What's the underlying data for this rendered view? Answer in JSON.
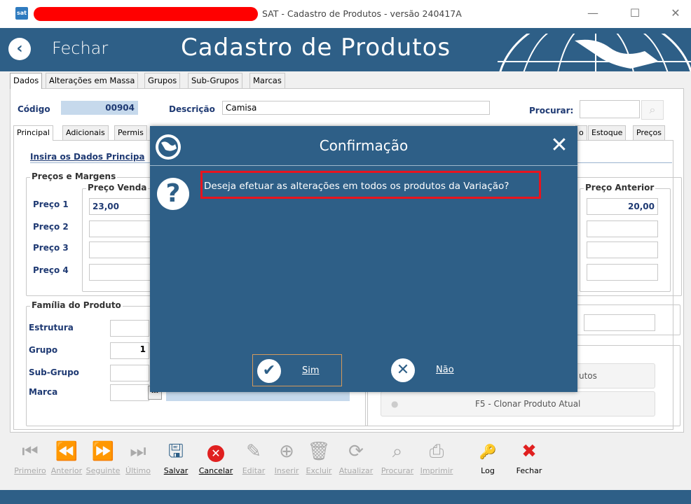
{
  "window": {
    "title": "SAT - Cadastro de Produtos - versão 240417A",
    "app_icon": "sat-icon"
  },
  "header": {
    "back_label": "Fechar",
    "title": "Cadastro de Produtos"
  },
  "main_tabs": [
    "Dados",
    "Alterações em Massa",
    "Grupos",
    "Sub-Grupos",
    "Marcas"
  ],
  "form": {
    "codigo_label": "Código",
    "codigo_value": "00904",
    "descricao_label": "Descrição",
    "descricao_value": "Camisa",
    "procurar_label": "Procurar:"
  },
  "sub_tabs_left": [
    "Principal",
    "Adicionais",
    "Permis"
  ],
  "sub_tabs_right": [
    "o",
    "Estoque",
    "Preços"
  ],
  "principal": {
    "insira_label": "Insira os Dados Principa",
    "precos_group": "Preços e Margens",
    "preco_venda_header": "Preço Venda",
    "preco_anterior_header": "Preço Anterior",
    "precos": [
      {
        "label": "Preço 1",
        "venda": "23,00",
        "anterior": "20,00"
      },
      {
        "label": "Preço 2",
        "venda": "",
        "anterior": ""
      },
      {
        "label": "Preço 3",
        "venda": "",
        "anterior": ""
      },
      {
        "label": "Preço 4",
        "venda": "",
        "anterior": ""
      }
    ],
    "familia_group": "Família do Produto",
    "familia": [
      {
        "label": "Estrutura",
        "value": ""
      },
      {
        "label": "Grupo",
        "value": "1"
      },
      {
        "label": "Sub-Grupo",
        "value": ""
      },
      {
        "label": "Marca",
        "value": ""
      }
    ],
    "btn_produtos_partial": "utos",
    "btn_clonar": "F5 - Clonar Produto Atual"
  },
  "toolbar": [
    {
      "label": "Primeiro",
      "icon": "first-icon",
      "enabled": false
    },
    {
      "label": "Anterior",
      "icon": "previous-icon",
      "enabled": false
    },
    {
      "label": "Seguinte",
      "icon": "next-icon",
      "enabled": false
    },
    {
      "label": "Último",
      "icon": "last-icon",
      "enabled": false
    },
    {
      "label": "Salvar",
      "icon": "save-icon",
      "enabled": true
    },
    {
      "label": "Cancelar",
      "icon": "cancel-icon",
      "enabled": true
    },
    {
      "label": "Editar",
      "icon": "edit-icon",
      "enabled": false
    },
    {
      "label": "Inserir",
      "icon": "insert-icon",
      "enabled": false
    },
    {
      "label": "Excluir",
      "icon": "delete-icon",
      "enabled": false
    },
    {
      "label": "Atualizar",
      "icon": "refresh-icon",
      "enabled": false
    },
    {
      "label": "Procurar",
      "icon": "search-icon",
      "enabled": false
    },
    {
      "label": "Imprimir",
      "icon": "print-icon",
      "enabled": false
    },
    {
      "label": "Log",
      "icon": "key-icon",
      "enabled": true
    },
    {
      "label": "Fechar",
      "icon": "close-x-icon",
      "enabled": true
    }
  ],
  "dialog": {
    "title": "Confirmação",
    "message": "Deseja efetuar as alterações em todos os produtos da Variação?",
    "yes_label": "Sim",
    "no_label": "Não"
  },
  "colors": {
    "header_blue": "#2e5f87",
    "label_blue": "#1f3a73",
    "highlight_red": "#e8141e",
    "cancel_red": "#e02020"
  }
}
